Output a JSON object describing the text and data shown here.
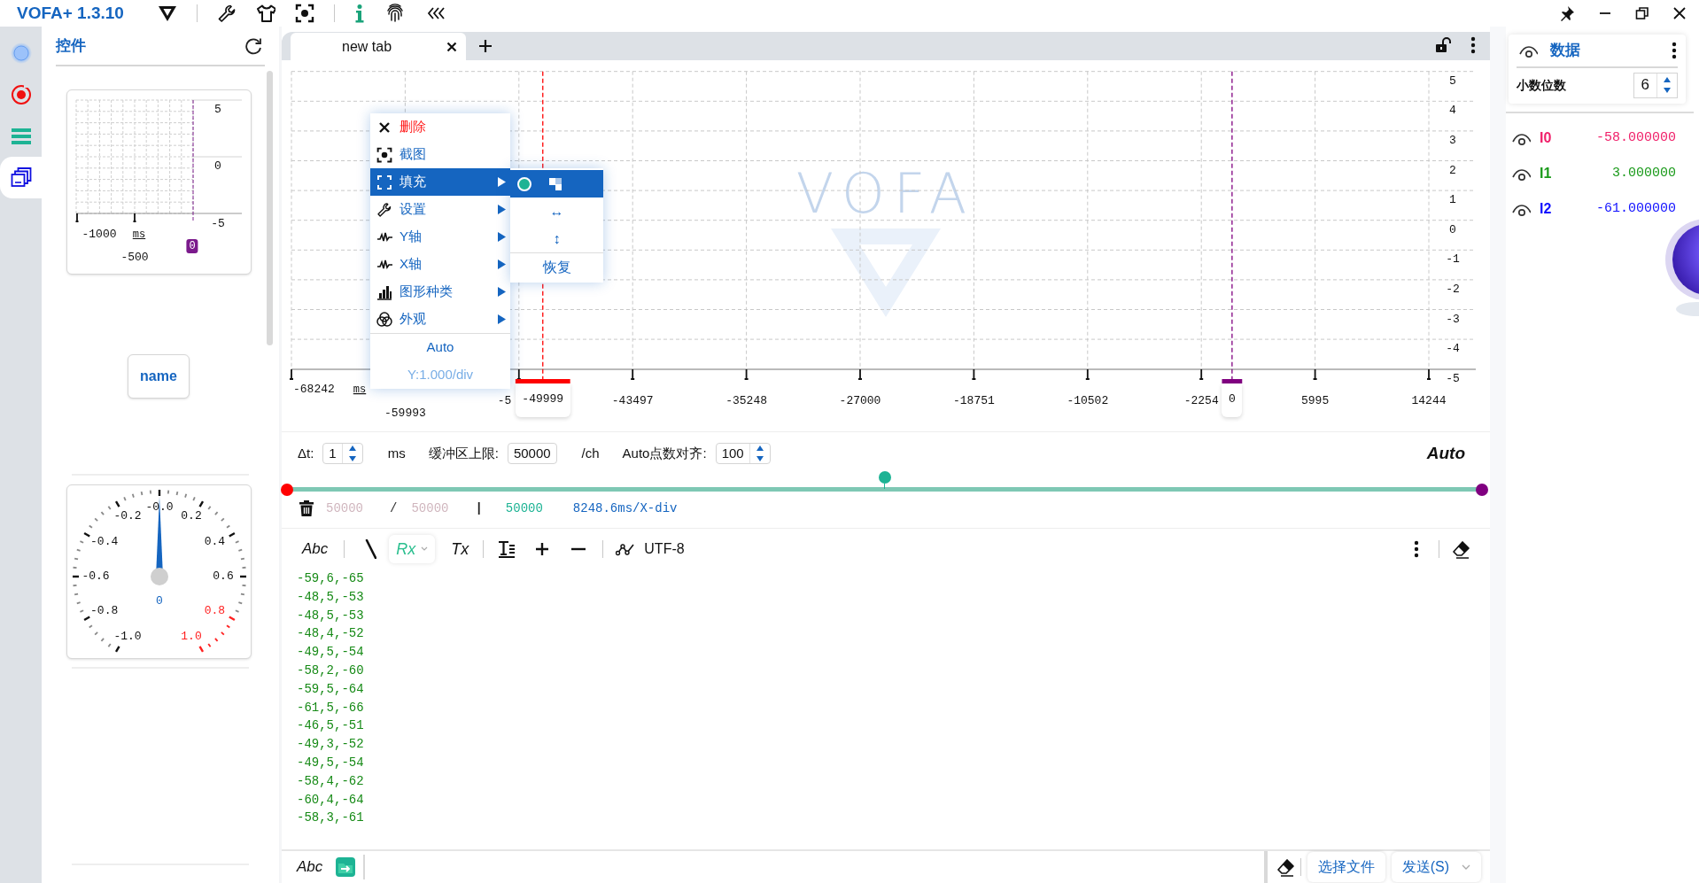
{
  "app_title": "VOFA+ 1.3.10",
  "rail": [
    {
      "kind": "status",
      "selected": false
    },
    {
      "kind": "record",
      "selected": false
    },
    {
      "kind": "list",
      "selected": false
    },
    {
      "kind": "widgets",
      "selected": true
    }
  ],
  "widgets_panel": {
    "title": "控件",
    "mini_chart": {
      "y_labels": [
        "5",
        "0",
        "-5"
      ],
      "x_labels": [
        "-1000",
        "-500"
      ],
      "unit": "ms",
      "cursor": {
        "label": "0",
        "color": "#7b1a8c"
      }
    },
    "button": {
      "label": "name"
    },
    "gauge": {
      "labels": [
        {
          "text": "-1.0",
          "alarm": false
        },
        {
          "text": "-0.8",
          "alarm": false
        },
        {
          "text": "-0.6",
          "alarm": false
        },
        {
          "text": "-0.4",
          "alarm": false
        },
        {
          "text": "-0.2",
          "alarm": false
        },
        {
          "text": "-0.0",
          "alarm": false
        },
        {
          "text": "0.2",
          "alarm": false
        },
        {
          "text": "0.4",
          "alarm": false
        },
        {
          "text": "0.6",
          "alarm": false
        },
        {
          "text": "0.8",
          "alarm": true
        },
        {
          "text": "1.0",
          "alarm": true
        }
      ],
      "value": "0",
      "level": 0.5
    }
  },
  "tabs": [
    {
      "label": "new tab",
      "selected": true
    }
  ],
  "chart": {
    "watermark": "VOFA",
    "unit": "ms",
    "y_labels": [
      "5",
      "4",
      "3",
      "2",
      "1",
      "0",
      "-1",
      "-2",
      "-3",
      "-4",
      "-5"
    ],
    "x_labels": [
      {
        "text": "-68242",
        "kind": "edge"
      },
      {
        "text": "-59993",
        "kind": "lower"
      },
      {
        "text": "-5",
        "kind": "partial"
      },
      {
        "text": "-43497",
        "kind": "tick"
      },
      {
        "text": "-35248",
        "kind": "tick"
      },
      {
        "text": "-27000",
        "kind": "tick"
      },
      {
        "text": "-18751",
        "kind": "tick"
      },
      {
        "text": "-10502",
        "kind": "tick"
      },
      {
        "text": "-2254",
        "kind": "tick"
      },
      {
        "text": "5995",
        "kind": "tick"
      },
      {
        "text": "14244",
        "kind": "tick"
      }
    ],
    "cursors": [
      {
        "label": "-49999",
        "color": "#ff0000",
        "level": 0.221
      },
      {
        "label": "0",
        "color": "#800080",
        "level": 0.827
      }
    ]
  },
  "context_menu": {
    "items": [
      {
        "label": "删除",
        "kind": "delete",
        "has_submenu": false,
        "selected": false
      },
      {
        "label": "截图",
        "kind": "screenshot",
        "has_submenu": false,
        "selected": false
      },
      {
        "label": "填充",
        "kind": "fill",
        "has_submenu": true,
        "selected": true
      },
      {
        "label": "设置",
        "kind": "settings",
        "has_submenu": true,
        "selected": false
      },
      {
        "label": "Y轴",
        "kind": "axis",
        "has_submenu": true,
        "selected": false
      },
      {
        "label": "X轴",
        "kind": "axis",
        "has_submenu": true,
        "selected": false
      },
      {
        "label": "图形种类",
        "kind": "chart-type",
        "has_submenu": true,
        "selected": false
      },
      {
        "label": "外观",
        "kind": "appearance",
        "has_submenu": true,
        "selected": false
      }
    ],
    "footer": [
      {
        "label": "Auto",
        "disabled": false
      },
      {
        "label": "Y:1.000/div",
        "disabled": true
      }
    ],
    "submenu": [
      {
        "kind": "swatches",
        "selected": true
      },
      {
        "kind": "text",
        "label": "↔",
        "selected": false
      },
      {
        "kind": "text",
        "label": "↕",
        "selected": false
      },
      {
        "kind": "action",
        "label": "恢复",
        "selected": false
      }
    ]
  },
  "controls": {
    "fields": [
      {
        "label": "Δt:",
        "value": "1",
        "unit": "ms",
        "spinner": true
      },
      {
        "label": "缓冲区上限:",
        "value": "50000",
        "unit": "/ch",
        "spinner": false
      },
      {
        "label": "Auto点数对齐:",
        "value": "100",
        "spinner": true
      }
    ],
    "mode": "Auto"
  },
  "range_slider": {
    "level": 0.5
  },
  "stats": [
    {
      "text": "50000",
      "kind": "count"
    },
    {
      "text": "/",
      "kind": "sep"
    },
    {
      "text": "50000",
      "kind": "count"
    },
    {
      "text": "|",
      "kind": "divider"
    },
    {
      "text": "50000",
      "kind": "total"
    },
    {
      "text": "8248.6ms/X-div",
      "kind": "scale"
    }
  ],
  "toolbar": {
    "format": "Abc",
    "rx": "Rx",
    "tx": "Tx",
    "encoding": "UTF-8"
  },
  "log": [
    "-59,6,-65",
    "-48,5,-53",
    "-48,5,-53",
    "-48,4,-52",
    "-49,5,-54",
    "-58,2,-60",
    "-59,5,-64",
    "-61,5,-66",
    "-46,5,-51",
    "-49,3,-52",
    "-49,5,-54",
    "-58,4,-62",
    "-60,4,-64",
    "-58,3,-61"
  ],
  "send_bar": {
    "format": "Abc",
    "buttons": [
      {
        "label": "选择文件",
        "dropdown": false
      },
      {
        "label": "发送(S)",
        "dropdown": true
      }
    ]
  },
  "data_panel": {
    "title": "数据",
    "decimals_label": "小数位数",
    "decimals": "6",
    "channels": [
      {
        "name": "I0",
        "value": "-58.000000",
        "color": "#f0206a"
      },
      {
        "name": "I1",
        "value": "3.000000",
        "color": "#1a9a1a"
      },
      {
        "name": "I2",
        "value": "-61.000000",
        "color": "#1010ff"
      }
    ]
  }
}
